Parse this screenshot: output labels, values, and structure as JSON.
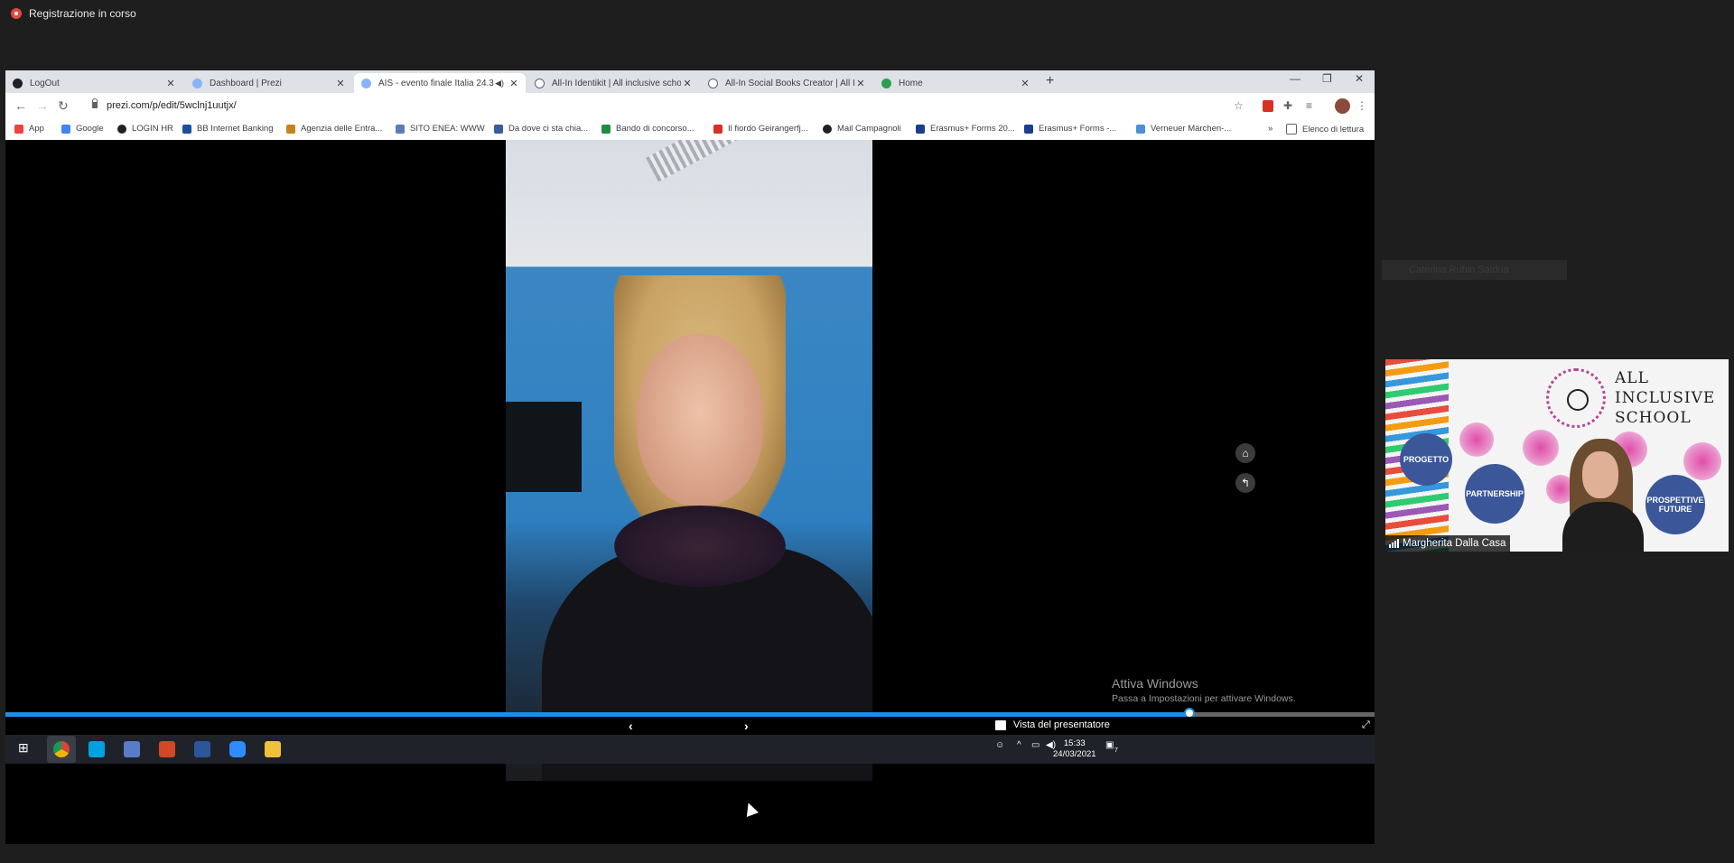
{
  "zoom": {
    "recording_label": "Registrazione in corso",
    "ghost_participant": "Caterina Rubin Saldua"
  },
  "browser": {
    "tabs": [
      {
        "title": "LogOut",
        "icon": "prezi-icon"
      },
      {
        "title": "Dashboard | Prezi",
        "icon": "info-icon"
      },
      {
        "title": "AIS - evento finale Italia 24.3",
        "icon": "info-icon",
        "active": true
      },
      {
        "title": "All-In Identikit | All inclusive scho",
        "icon": "globe-icon"
      },
      {
        "title": "All-In Social Books Creator | All In",
        "icon": "globe-icon"
      },
      {
        "title": "Home",
        "icon": "green-icon"
      }
    ],
    "url": "prezi.com/p/edit/5wclnj1uutjx/",
    "bookmarks": [
      {
        "label": "App",
        "color": "#e8453c"
      },
      {
        "label": "Google",
        "color": "#4285f4"
      },
      {
        "label": "LOGIN HR",
        "color": "#202124"
      },
      {
        "label": "BB Internet Banking",
        "color": "#1a4fa0"
      },
      {
        "label": "Agenzia delle Entra...",
        "color": "#c4841d"
      },
      {
        "label": "SITO ENEA: WWW",
        "color": "#5a7db8"
      },
      {
        "label": "Da dove ci sta chia...",
        "color": "#3a5ba0"
      },
      {
        "label": "Bando di concorso...",
        "color": "#1e8e3e"
      },
      {
        "label": "Il fiordo Geirangerfj...",
        "color": "#d93025"
      },
      {
        "label": "Mail Campagnoli",
        "color": "#202124"
      },
      {
        "label": "Erasmus+ Forms 20...",
        "color": "#1a3d8f"
      },
      {
        "label": "Erasmus+ Forms -...",
        "color": "#1a3d8f"
      },
      {
        "label": "Verneuer Märchen-...",
        "color": "#4a90d9"
      }
    ],
    "reading_list": "Elenco di lettura",
    "overflow": "»"
  },
  "prezi": {
    "watermark_title": "Attiva Windows",
    "watermark_sub": "Passa a Impostazioni per attivare Windows.",
    "progress": 0.865,
    "presenter_view": "Vista del presentatore"
  },
  "taskbar": {
    "time": "15:33",
    "date": "24/03/2021",
    "notifications": "7"
  },
  "thumbnail": {
    "title_lines": [
      "ALL",
      "INCLUSIVE",
      "SCHOOL"
    ],
    "bubbles": [
      "PROGETTO",
      "PARTNERSHIP",
      "PROSPETTIVE FUTURE"
    ],
    "name": "Margherita Dalla Casa"
  }
}
